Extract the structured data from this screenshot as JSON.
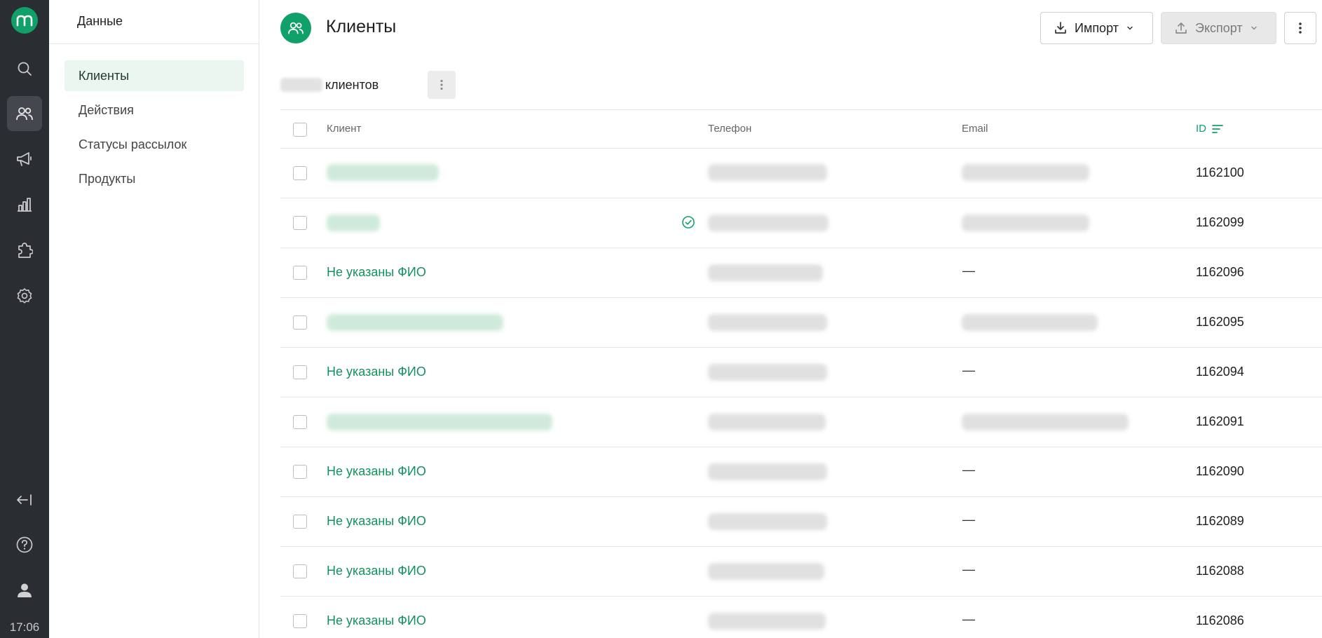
{
  "rail": {
    "clock": "17:06",
    "icons": [
      "logo-icon",
      "search-icon",
      "clients-icon",
      "campaigns-icon",
      "analytics-icon",
      "integrations-icon",
      "settings-icon",
      "collapse-icon",
      "help-icon",
      "profile-icon"
    ]
  },
  "sidebar": {
    "title": "Данные",
    "items": [
      {
        "label": "Клиенты",
        "active": true
      },
      {
        "label": "Действия",
        "active": false
      },
      {
        "label": "Статусы рассылок",
        "active": false
      },
      {
        "label": "Продукты",
        "active": false
      }
    ]
  },
  "header": {
    "title": "Клиенты",
    "import_label": "Импорт",
    "export_label": "Экспорт"
  },
  "summary": {
    "count_suffix": "клиентов"
  },
  "table": {
    "columns": {
      "client": "Клиент",
      "phone": "Телефон",
      "email": "Email",
      "id": "ID"
    },
    "rows": [
      {
        "name": "",
        "email": "",
        "id": "1162100"
      },
      {
        "name": "",
        "email": "",
        "id": "1162099"
      },
      {
        "name": "Не указаны ФИО",
        "email": "—",
        "id": "1162096"
      },
      {
        "name": "",
        "email": "",
        "id": "1162095"
      },
      {
        "name": "Не указаны ФИО",
        "email": "—",
        "id": "1162094"
      },
      {
        "name": "",
        "email": "",
        "id": "1162091"
      },
      {
        "name": "Не указаны ФИО",
        "email": "—",
        "id": "1162090"
      },
      {
        "name": "Не указаны ФИО",
        "email": "—",
        "id": "1162089"
      },
      {
        "name": "Не указаны ФИО",
        "email": "—",
        "id": "1162088"
      },
      {
        "name": "Не указаны ФИО",
        "email": "—",
        "id": "1162086"
      }
    ]
  },
  "colors": {
    "accent": "#12a06a",
    "rail": "#2a2d31",
    "link": "#12915e"
  }
}
